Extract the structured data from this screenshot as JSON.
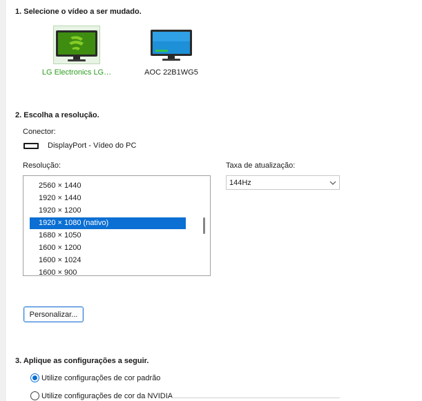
{
  "section1": {
    "title": "1. Selecione o vídeo a ser mudado."
  },
  "monitors": [
    {
      "label": "LG Electronics LG…",
      "selected": true,
      "icon": "nvidia-monitor-icon"
    },
    {
      "label": "AOC 22B1WG5",
      "selected": false,
      "icon": "monitor-icon"
    }
  ],
  "section2": {
    "title": "2. Escolha a resolução.",
    "connector_label": "Conector:",
    "connector_value": "DisplayPort - Vídeo do PC",
    "resolution_label": "Resolução:",
    "resolutions": [
      "2560 × 1440",
      "1920 × 1440",
      "1920 × 1200",
      "1920 × 1080 (nativo)",
      "1680 × 1050",
      "1600 × 1200",
      "1600 × 1024",
      "1600 × 900"
    ],
    "selected_resolution": "1920 × 1080 (nativo)",
    "refresh_label": "Taxa de atualização:",
    "refresh_value": "144Hz",
    "customize_button": "Personalizar..."
  },
  "section3": {
    "title": "3. Aplique as configurações a seguir.",
    "options": [
      {
        "label": "Utilize configurações de cor padrão",
        "checked": true
      },
      {
        "label": "Utilize configurações de cor da NVIDIA",
        "checked": false
      }
    ]
  },
  "colors": {
    "accent": "#0b6fd3",
    "selected_monitor_text": "#2b9b1d",
    "nvidia_green": "#76b900"
  }
}
